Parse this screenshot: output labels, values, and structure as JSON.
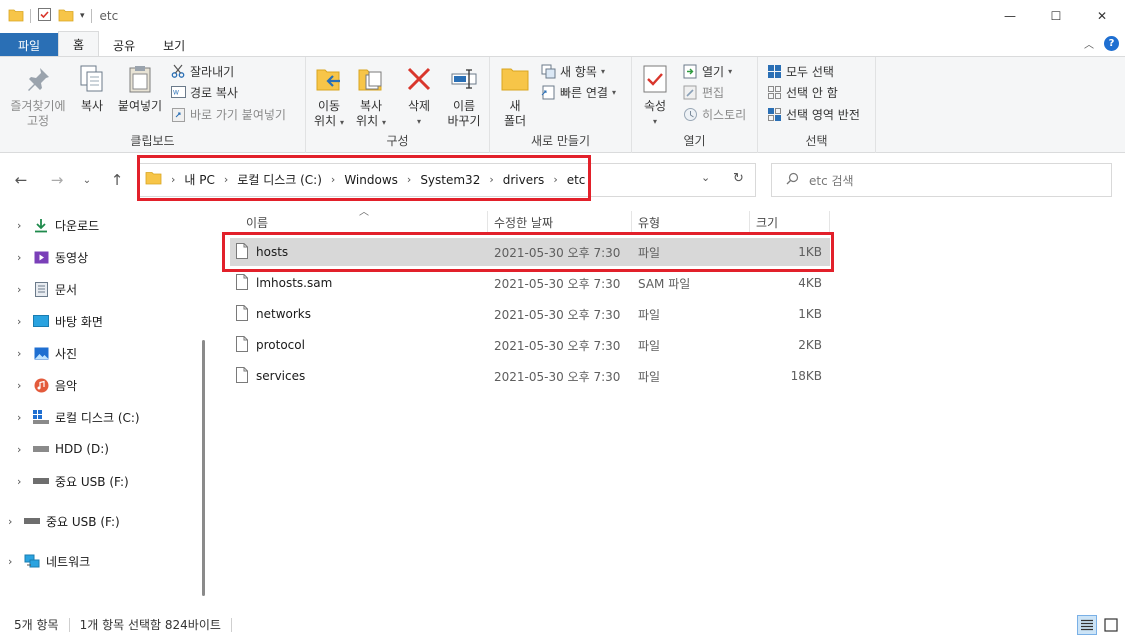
{
  "window": {
    "title": "etc",
    "minimize": "—",
    "maximize": "☐",
    "close": "✕"
  },
  "tabs": [
    {
      "label": "파일"
    },
    {
      "label": "홈"
    },
    {
      "label": "공유"
    },
    {
      "label": "보기"
    }
  ],
  "ribbon": {
    "clipboard": {
      "pin": [
        "즐겨찾기에",
        "고정"
      ],
      "copy": "복사",
      "paste": "붙여넣기",
      "cut": "잘라내기",
      "copy_path": "경로 복사",
      "paste_shortcut": "바로 가기 붙여넣기",
      "label": "클립보드"
    },
    "organize": {
      "move": [
        "이동",
        "위치"
      ],
      "copy": [
        "복사",
        "위치"
      ],
      "delete": "삭제",
      "rename": [
        "이름",
        "바꾸기"
      ],
      "label": "구성"
    },
    "new": {
      "folder": [
        "새",
        "폴더"
      ],
      "new_item": "새 항목",
      "quick_access": "빠른 연결",
      "label": "새로 만들기"
    },
    "open": {
      "properties": "속성",
      "open": "열기",
      "edit": "편집",
      "history": "히스토리",
      "label": "열기"
    },
    "select": {
      "select_all": "모두 선택",
      "select_none": "선택 안 함",
      "invert": "선택 영역 반전",
      "label": "선택"
    }
  },
  "address": {
    "crumbs": [
      "내 PC",
      "로컬 디스크 (C:)",
      "Windows",
      "System32",
      "drivers",
      "etc"
    ]
  },
  "search": {
    "placeholder": "etc 검색"
  },
  "nav_pane": [
    {
      "label": "다운로드",
      "icon": "download-icon"
    },
    {
      "label": "동영상",
      "icon": "videos-icon"
    },
    {
      "label": "문서",
      "icon": "documents-icon"
    },
    {
      "label": "바탕 화면",
      "icon": "desktop-icon"
    },
    {
      "label": "사진",
      "icon": "pictures-icon"
    },
    {
      "label": "음악",
      "icon": "music-icon"
    },
    {
      "label": "로컬 디스크 (C:)",
      "icon": "drive-c-icon"
    },
    {
      "label": "HDD (D:)",
      "icon": "drive-icon"
    },
    {
      "label": "중요 USB (F:)",
      "icon": "usb-drive-icon"
    },
    {
      "label": "중요 USB (F:)",
      "icon": "usb-drive-icon"
    },
    {
      "label": "네트워크",
      "icon": "network-icon"
    }
  ],
  "columns": {
    "name": "이름",
    "date": "수정한 날짜",
    "type": "유형",
    "size": "크기"
  },
  "files": [
    {
      "name": "hosts",
      "date": "2021-05-30 오후 7:30",
      "type": "파일",
      "size": "1KB",
      "selected": true
    },
    {
      "name": "lmhosts.sam",
      "date": "2021-05-30 오후 7:30",
      "type": "SAM 파일",
      "size": "4KB",
      "selected": false
    },
    {
      "name": "networks",
      "date": "2021-05-30 오후 7:30",
      "type": "파일",
      "size": "1KB",
      "selected": false
    },
    {
      "name": "protocol",
      "date": "2021-05-30 오후 7:30",
      "type": "파일",
      "size": "2KB",
      "selected": false
    },
    {
      "name": "services",
      "date": "2021-05-30 오후 7:30",
      "type": "파일",
      "size": "18KB",
      "selected": false
    }
  ],
  "status": {
    "count": "5개 항목",
    "selection": "1개 항목 선택함 824바이트"
  },
  "colors": {
    "accent": "#2a6fb5",
    "highlight": "#e2202a",
    "selected_row": "#d8d8d8",
    "folder": "#f7c548"
  }
}
